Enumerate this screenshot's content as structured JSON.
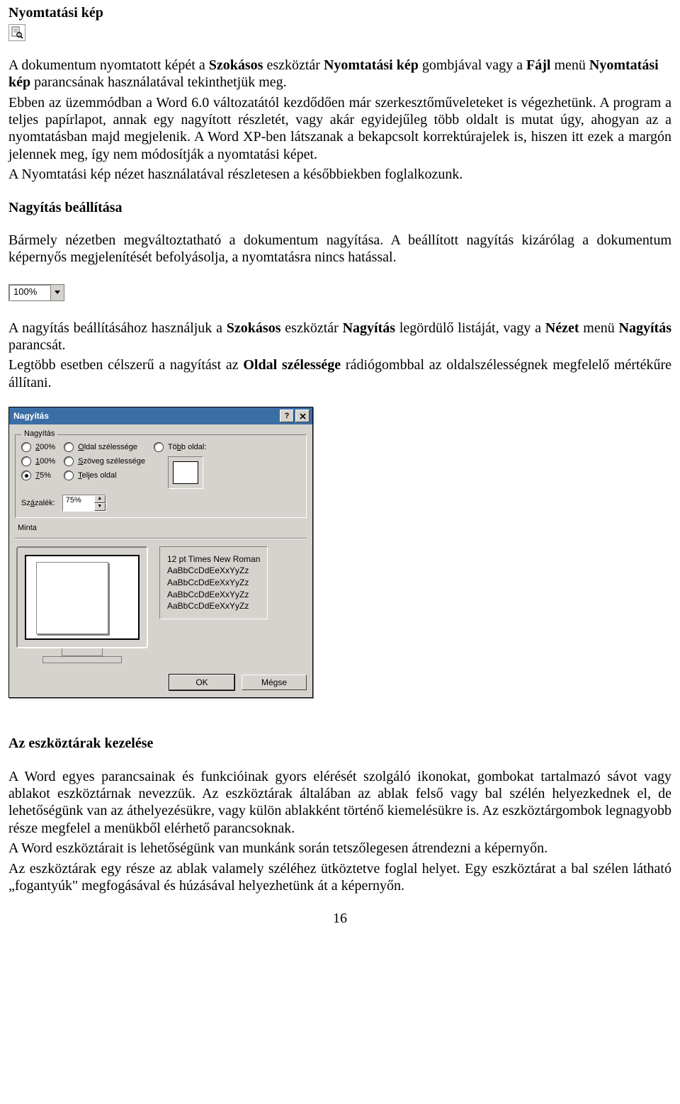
{
  "heading1": "Nyomtatási kép",
  "para1_parts": [
    {
      "t": "A dokumentum nyomtatott képét a ",
      "b": false
    },
    {
      "t": "Szokásos",
      "b": true
    },
    {
      "t": " eszköztár ",
      "b": false
    },
    {
      "t": "Nyomtatási kép",
      "b": true
    },
    {
      "t": " gombjával vagy a ",
      "b": false
    },
    {
      "t": "Fájl",
      "b": true
    },
    {
      "t": " menü ",
      "b": false
    },
    {
      "t": "Nyomtatási kép",
      "b": true
    },
    {
      "t": " parancsának használatával tekinthetjük meg.",
      "b": false
    }
  ],
  "para2": "Ebben az üzemmódban a Word 6.0 változatától kezdődően már szerkesztőműveleteket is végezhetünk. A program a teljes papírlapot, annak egy nagyított részletét, vagy akár egyidejűleg több oldalt is mutat úgy, ahogyan az a nyomtatásban majd megjelenik. A Word XP-ben látszanak a bekapcsolt korrektúrajelek is, hiszen itt ezek a margón jelennek meg, így nem módosítják a nyomtatási képet.",
  "para3": "A Nyomtatási kép nézet használatával részletesen a későbbiekben foglalkozunk.",
  "heading2": "Nagyítás beállítása",
  "para4": "Bármely nézetben megváltoztatható a dokumentum nagyítása. A beállított nagyítás kizárólag a dokumentum képernyős megjelenítését befolyásolja, a nyomtatásra nincs hatással.",
  "dropdown_value": "100%",
  "para5_parts": [
    {
      "t": "A nagyítás beállításához használjuk a ",
      "b": false
    },
    {
      "t": "Szokásos",
      "b": true
    },
    {
      "t": " eszköztár ",
      "b": false
    },
    {
      "t": "Nagyítás",
      "b": true
    },
    {
      "t": " legördülő listáját, vagy a ",
      "b": false
    },
    {
      "t": "Nézet",
      "b": true
    },
    {
      "t": " menü ",
      "b": false
    },
    {
      "t": "Nagyítás",
      "b": true
    },
    {
      "t": " parancsát.",
      "b": false
    }
  ],
  "para6_parts": [
    {
      "t": "Legtöbb esetben célszerű a nagyítást az ",
      "b": false
    },
    {
      "t": "Oldal szélessége",
      "b": true
    },
    {
      "t": " rádiógombbal az oldalszélességnek megfelelő mértékűre állítani.",
      "b": false
    }
  ],
  "dialog": {
    "title": "Nagyítás",
    "group_label": "Nagyítás",
    "radios_col1": [
      {
        "u": "2",
        "rest": "00%",
        "selected": false
      },
      {
        "u": "1",
        "rest": "00%",
        "selected": false
      },
      {
        "u": "7",
        "rest": "5%",
        "selected": true
      }
    ],
    "radios_col2": [
      {
        "pre": "",
        "u": "O",
        "rest": "ldal szélessége",
        "selected": false
      },
      {
        "pre": "",
        "u": "S",
        "rest": "zöveg szélessége",
        "selected": false
      },
      {
        "pre": "",
        "u": "T",
        "rest": "eljes oldal",
        "selected": false
      }
    ],
    "radio_col3": {
      "pre": "Tö",
      "u": "b",
      "rest": "b oldal:",
      "selected": false
    },
    "percent_label_u": "á",
    "percent_label_pre": "Sz",
    "percent_label_post": "zalék:",
    "percent_value": "75%",
    "minta_label": "Minta",
    "preview_font": "12 pt Times New Roman",
    "preview_lines": [
      "AaBbCcDdEeXxYyZz",
      "AaBbCcDdEeXxYyZz",
      "AaBbCcDdEeXxYyZz",
      "AaBbCcDdEeXxYyZz"
    ],
    "ok": "OK",
    "cancel": "Mégse"
  },
  "heading3": "Az eszköztárak kezelése",
  "para7": "A Word egyes parancsainak és funkcióinak gyors elérését szolgáló ikonokat, gombokat tartalmazó sávot vagy ablakot eszköztárnak nevezzük. Az eszköztárak általában az ablak felső vagy bal szélén helyezkednek el, de lehetőségünk van az áthelyezésükre, vagy külön ablakként történő kiemelésükre is. Az eszköztárgombok legnagyobb része megfelel a menükből elérhető parancsoknak.",
  "para8": "A Word eszköztárait is lehetőségünk van munkánk során tetszőlegesen átrendezni a képernyőn.",
  "para9": "Az eszköztárak egy része az ablak valamely széléhez ütköztetve foglal helyet. Egy eszköztárat a bal szélen látható „fogantyúk\" megfogásával és húzásával helyezhetünk át a képernyőn.",
  "page_number": "16"
}
